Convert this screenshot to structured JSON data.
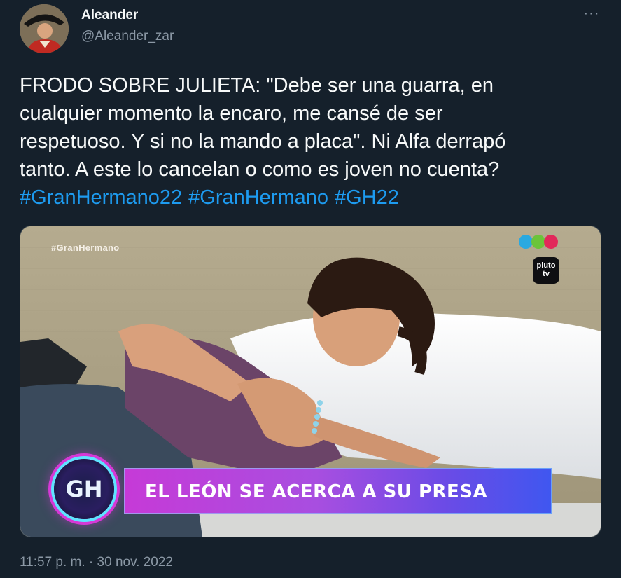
{
  "tweet": {
    "display_name": "Aleander",
    "handle": "@Aleander_zar",
    "more_icon": "more-horizontal-icon",
    "text": "FRODO SOBRE JULIETA: \"Debe ser una guarra, en\ncualquier momento la encaro, me cansé de ser\nrespetuoso. Y si no la mando a placa\". Ni Alfa derrapó\ntanto. A este lo cancelan o como es joven no cuenta?",
    "hashtags": [
      "#GranHermano22",
      "#GranHermano",
      "#GH22"
    ],
    "timestamp": "11:57 p. m. · 30 nov. 2022"
  },
  "media": {
    "watermark": "#GranHermano",
    "lower_third": "EL LEÓN SE ACERCA A SU PRESA",
    "show_logo": "GH",
    "pluto_logo": "pluto tv"
  },
  "colors": {
    "background": "#15202b",
    "link": "#1d9bf0",
    "secondary_text": "#8b98a5"
  }
}
